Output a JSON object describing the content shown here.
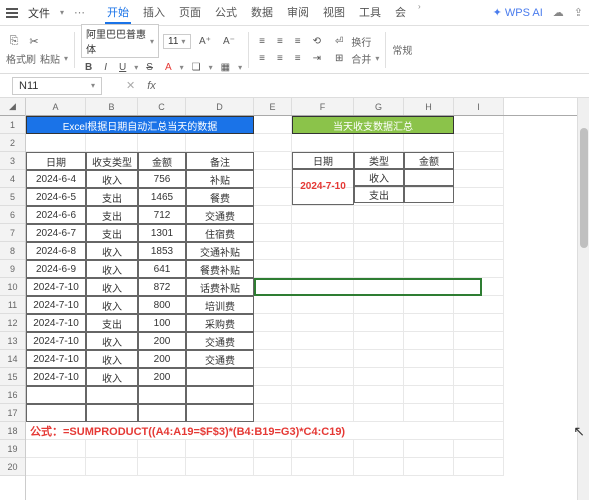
{
  "titlebar": {
    "file": "文件",
    "tabs": [
      "开始",
      "插入",
      "页面",
      "公式",
      "数据",
      "审阅",
      "视图",
      "工具",
      "会"
    ],
    "ai": "WPS AI"
  },
  "ribbon": {
    "fmt": "格式刷",
    "paste": "粘贴",
    "font": "阿里巴巴普惠体",
    "size": "11",
    "wrap": "换行",
    "merge": "合并",
    "cell": "常规"
  },
  "namebox": "N11",
  "cols": [
    "A",
    "B",
    "C",
    "D",
    "E",
    "F",
    "G",
    "H",
    "I"
  ],
  "left": {
    "title": "Excel根据日期自动汇总当天的数据",
    "headers": [
      "日期",
      "收支类型",
      "金额",
      "备注"
    ],
    "rows": [
      [
        "2024-6-4",
        "收入",
        "756",
        "补贴"
      ],
      [
        "2024-6-5",
        "支出",
        "1465",
        "餐费"
      ],
      [
        "2024-6-6",
        "支出",
        "712",
        "交通费"
      ],
      [
        "2024-6-7",
        "支出",
        "1301",
        "住宿费"
      ],
      [
        "2024-6-8",
        "收入",
        "1853",
        "交通补贴"
      ],
      [
        "2024-6-9",
        "收入",
        "641",
        "餐费补贴"
      ],
      [
        "2024-7-10",
        "收入",
        "872",
        "话费补贴"
      ],
      [
        "2024-7-10",
        "收入",
        "800",
        "培训费"
      ],
      [
        "2024-7-10",
        "支出",
        "100",
        "采购费"
      ],
      [
        "2024-7-10",
        "收入",
        "200",
        "交通费"
      ],
      [
        "2024-7-10",
        "收入",
        "200",
        "交通费"
      ],
      [
        "2024-7-10",
        "收入",
        "200",
        ""
      ]
    ]
  },
  "right": {
    "title": "当天收支数据汇总",
    "headers": [
      "日期",
      "类型",
      "金额"
    ],
    "date": "2024-7-10",
    "r1": "收入",
    "r2": "支出"
  },
  "formula": "公式：=SUMPRODUCT((A4:A19=$F$3)*(B4:B19=G3)*C4:C19)"
}
